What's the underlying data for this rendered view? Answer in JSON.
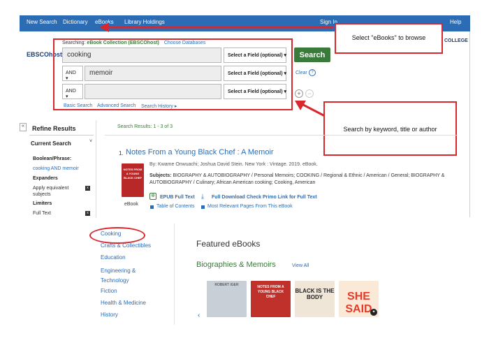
{
  "topnav": {
    "items": [
      "New Search",
      "Dictionary",
      "eBooks",
      "Library Holdings",
      "Sign In",
      "Help"
    ]
  },
  "header": {
    "logo": "EBSCOhost",
    "college": "COLLEGE"
  },
  "search": {
    "searching_label": "Searching:",
    "collection": "eBook Collection (EBSCOhost)",
    "choose_db": "Choose Databases",
    "rows": [
      {
        "bool": "",
        "value": "cooking",
        "field": "Select a Field (optional)"
      },
      {
        "bool": "AND",
        "value": "memoir",
        "field": "Select a Field (optional)"
      },
      {
        "bool": "AND",
        "value": "",
        "field": "Select a Field (optional)"
      }
    ],
    "search_button": "Search",
    "clear": "Clear",
    "basic": "Basic Search",
    "advanced": "Advanced Search",
    "history": "Search History"
  },
  "callouts": {
    "ebooks": "Select \"eBooks\" to browse",
    "keyword": "Search by keyword, title or author"
  },
  "sidebar": {
    "refine": "Refine Results",
    "current": "Current Search",
    "boolean_label": "Boolean/Phrase:",
    "boolean_value": "cooking AND memoir",
    "expanders": "Expanders",
    "expander_item": "Apply equivalent subjects",
    "limiters": "Limiters",
    "limiter_item": "Full Text"
  },
  "results": {
    "count": "Search Results: 1 - 3 of 3",
    "number": "1.",
    "title": "Notes From a Young Black Chef : A Memoir",
    "byline": "By: Kwame Onwuachi; Joshua David Stein. New York : Vintage. 2019. eBook.",
    "subjects_label": "Subjects:",
    "subjects": "BIOGRAPHY & AUTOBIOGRAPHY / Personal Memoirs; COOKING / Regional & Ethnic / American / General; BIOGRAPHY & AUTOBIOGRAPHY / Culinary; African American cooking; Cooking, American",
    "epub": "EPUB Full Text",
    "download": "Full Download",
    "primo": "Check Primo Link for Full Text",
    "toc": "Table of Contents",
    "relevant": "Most Relevant Pages From This eBook",
    "format": "eBook",
    "cover_text": "NOTES FROM A YOUNG BLACK CHEF"
  },
  "browse": {
    "categories": [
      "Cooking",
      "Crafts & Collectibles",
      "Education",
      "Engineering & Technology",
      "Fiction",
      "Health & Medicine",
      "History"
    ],
    "featured": "Featured eBooks",
    "section": "Biographies & Memoirs",
    "view_all": "View All",
    "covers": [
      "ROBERT IGER",
      "NOTES FROM A YOUNG BLACK CHEF",
      "BLACK IS THE BODY",
      "SHE SAID"
    ]
  },
  "colors": {
    "nav": "#2b6cb5",
    "annotation": "#d9272e",
    "search_button": "#3a7a3a"
  }
}
